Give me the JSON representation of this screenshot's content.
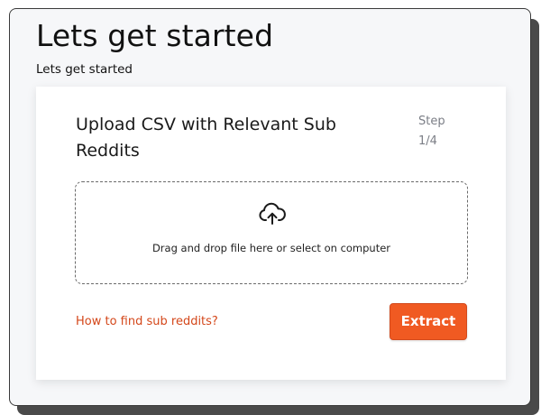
{
  "page": {
    "title": "Lets get started",
    "subtitle": "Lets get started"
  },
  "card": {
    "title": "Upload CSV with Relevant Sub Reddits",
    "step_label": "Step",
    "step_count": "1/4"
  },
  "dropzone": {
    "icon": "cloud-upload-icon",
    "text_prefix": "Drag and drop file here or ",
    "select_link": "select on computer"
  },
  "footer": {
    "help_link": "How to find sub reddits?",
    "extract_label": "Extract"
  },
  "colors": {
    "accent": "#f05a22",
    "link": "#d4471a",
    "muted": "#7b7e86",
    "background": "#f6f7f9"
  }
}
